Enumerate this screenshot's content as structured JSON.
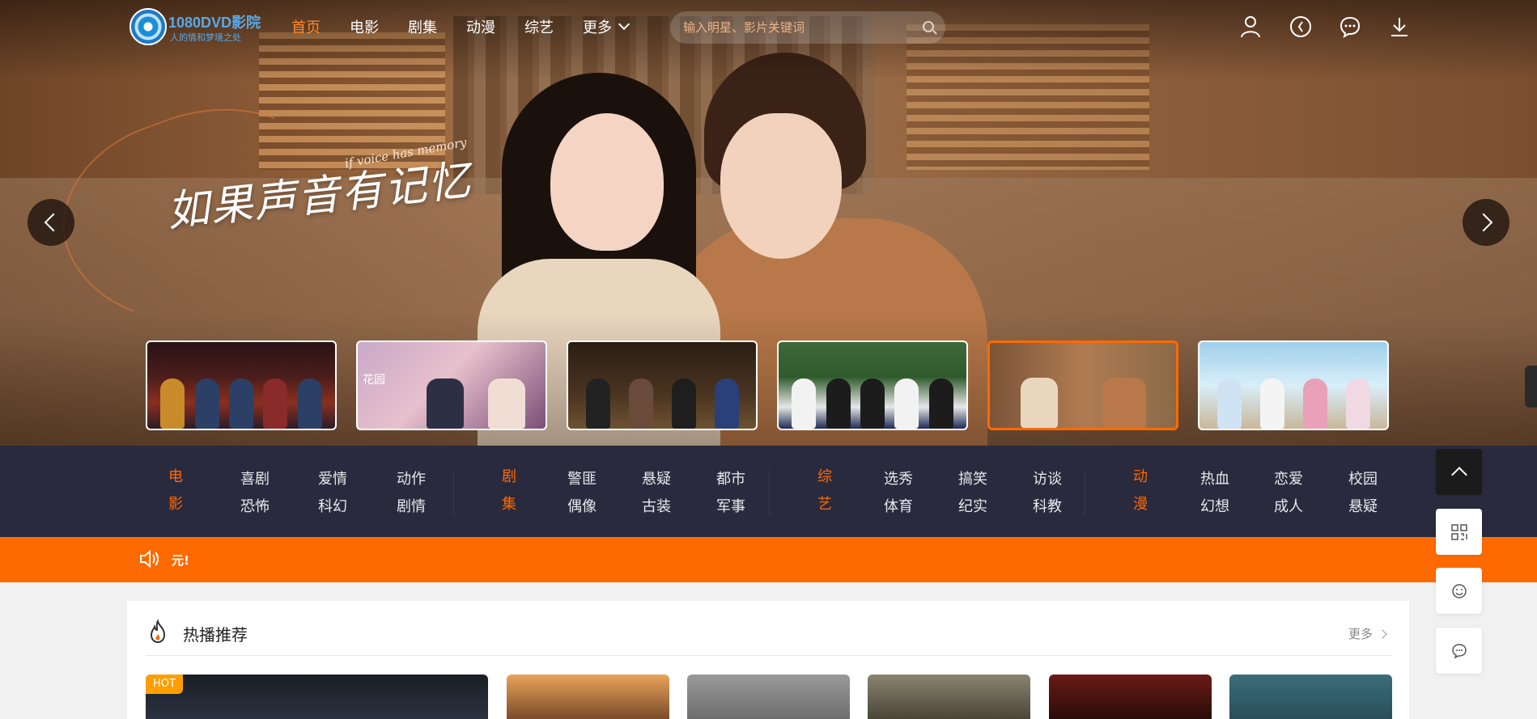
{
  "header": {
    "logo_name": "1080DVD影院",
    "logo_tagline": "人的情和梦境之处",
    "nav": [
      {
        "label": "首页",
        "active": true
      },
      {
        "label": "电影",
        "active": false
      },
      {
        "label": "剧集",
        "active": false
      },
      {
        "label": "动漫",
        "active": false
      },
      {
        "label": "综艺",
        "active": false
      },
      {
        "label": "更多",
        "active": false
      }
    ],
    "search_placeholder": "输入明星、影片关键词",
    "icons": [
      "user-icon",
      "history-icon",
      "message-icon",
      "download-icon"
    ]
  },
  "hero": {
    "title": "如果声音有记忆",
    "subtitle": "if voice has memory",
    "thumbnails": [
      {
        "name": "firefighters",
        "active": false
      },
      {
        "name": "garden-drama",
        "label": "花园",
        "active": false
      },
      {
        "name": "stage-singers",
        "active": false
      },
      {
        "name": "sports-show",
        "active": false
      },
      {
        "name": "if-voice-has-memory",
        "active": true
      },
      {
        "name": "beach-show",
        "active": false
      }
    ]
  },
  "categories": [
    {
      "head": [
        "电",
        "影"
      ],
      "links": [
        "喜剧",
        "爱情",
        "动作",
        "恐怖",
        "科幻",
        "剧情"
      ]
    },
    {
      "head": [
        "剧",
        "集"
      ],
      "links": [
        "警匪",
        "悬疑",
        "都市",
        "偶像",
        "古装",
        "军事"
      ]
    },
    {
      "head": [
        "综",
        "艺"
      ],
      "links": [
        "选秀",
        "搞笑",
        "访谈",
        "体育",
        "纪实",
        "科教"
      ]
    },
    {
      "head": [
        "动",
        "漫"
      ],
      "links": [
        "热血",
        "恋爱",
        "校园",
        "幻想",
        "成人",
        "悬疑"
      ]
    }
  ],
  "notice": {
    "text": "元!"
  },
  "section": {
    "title": "热播推荐",
    "more": "更多",
    "badge": "HOT"
  },
  "colors": {
    "accent": "#ff6a00",
    "nav_active": "#ff8a2a",
    "catbar": "#2a2a3e"
  }
}
